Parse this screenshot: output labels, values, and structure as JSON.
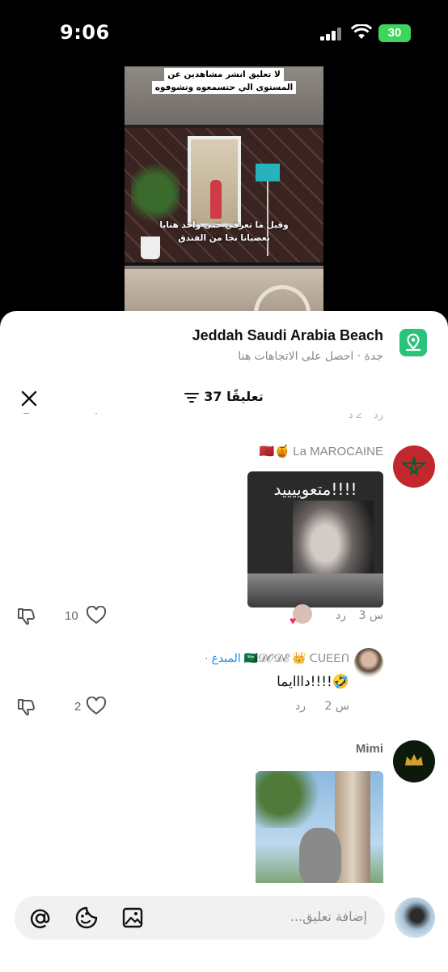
{
  "status": {
    "time": "9:06",
    "battery": "30"
  },
  "video": {
    "caption_top_1": "لا تعليق انشر مشاهدين عن",
    "caption_top_2": "المستوى الي حتسمعوه وتشوفوه",
    "caption_bottom_1": "وقبل ما تعرفي حتى واحد هنايا",
    "caption_bottom_2": "بعضيانا نجا من الفندق"
  },
  "location": {
    "title": "Jeddah Saudi Arabia Beach",
    "subtitle": "جدة · احصل على الاتجاهات هنا",
    "icon": "map-pin-icon",
    "icon_color": "#2ac37a"
  },
  "comments_header": {
    "count_label": "37 تعليقًا"
  },
  "faded_row": {
    "reply_label": "ردّ",
    "time": "2 د"
  },
  "comments": [
    {
      "name": "🇲🇦🍯 La MAROCAINE",
      "image_text": "متعوييييد!!!!",
      "likes": "10",
      "time": "3 س",
      "reply_label": "رد"
    },
    {
      "name_main": "🇸🇦𝓓𝓞𝓓𝓔 👑 ᑕᑌEEᑎ",
      "name_badge": "· المبدع",
      "text": "دااايما!!!!🤣",
      "likes": "2",
      "time": "2 س",
      "reply_label": "رد"
    },
    {
      "name": "Mimi"
    }
  ],
  "composer": {
    "placeholder": "إضافة تعليق..."
  },
  "colors": {
    "like_accent": "#fe2c55",
    "badge": "#1a8fd6"
  }
}
